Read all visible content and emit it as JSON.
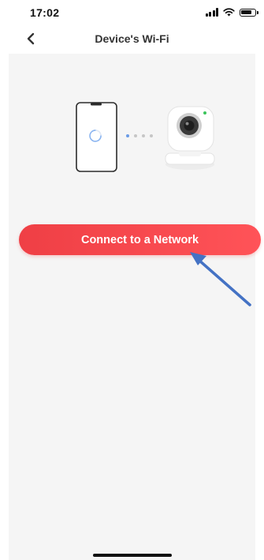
{
  "status_bar": {
    "time": "17:02",
    "battery_level": 0.85
  },
  "nav": {
    "title": "Device's Wi-Fi",
    "back_icon": "chevron-left-icon"
  },
  "illustration": {
    "phone_icon": "phone-icon",
    "loading_icon": "loading-spinner-icon",
    "connection_dots_icon": "connection-dots-icon",
    "camera_icon": "camera-icon",
    "camera_status_color": "#3bc45b"
  },
  "main": {
    "connect_button_label": "Connect to a Network"
  },
  "annotation": {
    "arrow_color": "#4472c4"
  },
  "colors": {
    "accent": "#ef3f45",
    "content_background": "#f5f5f5"
  }
}
